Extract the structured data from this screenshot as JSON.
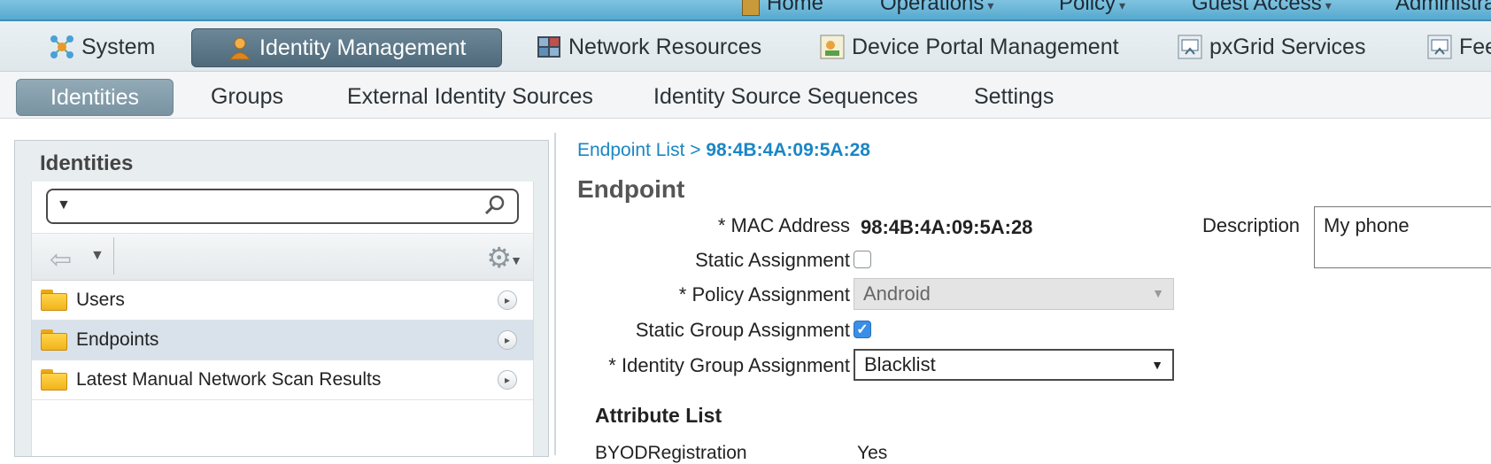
{
  "top_nav": {
    "items": [
      {
        "label": "Home",
        "caret": ""
      },
      {
        "label": "Operations",
        "caret": "▾"
      },
      {
        "label": "Policy",
        "caret": "▾"
      },
      {
        "label": "Guest Access",
        "caret": "▾"
      },
      {
        "label": "Administra",
        "caret": ""
      }
    ]
  },
  "main_tabs": [
    {
      "label": "System",
      "icon": "network-icon"
    },
    {
      "label": "Identity Management",
      "icon": "user-icon",
      "active": true
    },
    {
      "label": "Network Resources",
      "icon": "server-grid-icon"
    },
    {
      "label": "Device Portal Management",
      "icon": "portal-icon"
    },
    {
      "label": "pxGrid Services",
      "icon": "pxgrid-icon"
    },
    {
      "label": "Fee",
      "icon": "feed-icon"
    }
  ],
  "sub_tabs": [
    {
      "label": "Identities",
      "active": true
    },
    {
      "label": "Groups"
    },
    {
      "label": "External Identity Sources"
    },
    {
      "label": "Identity Source Sequences"
    },
    {
      "label": "Settings"
    }
  ],
  "left_panel": {
    "title": "Identities",
    "search_value": "",
    "tree": [
      {
        "label": "Users"
      },
      {
        "label": "Endpoints",
        "selected": true
      },
      {
        "label": "Latest Manual Network Scan Results"
      }
    ]
  },
  "breadcrumb": {
    "parent": "Endpoint List",
    "separator": ">",
    "current": "98:4B:4A:09:5A:28"
  },
  "endpoint": {
    "title": "Endpoint",
    "mac_label": "* MAC Address",
    "mac_value": "98:4B:4A:09:5A:28",
    "static_assignment_label": "Static Assignment",
    "static_assignment_checked": false,
    "policy_label": "* Policy Assignment",
    "policy_value": "Android",
    "static_group_label": "Static Group Assignment",
    "static_group_checked": true,
    "identity_group_label": "* Identity Group Assignment",
    "identity_group_value": "Blacklist",
    "description_label": "Description",
    "description_value": "My phone"
  },
  "attributes": {
    "title": "Attribute List",
    "rows": [
      {
        "name": "BYODRegistration",
        "value": "Yes"
      }
    ]
  },
  "colors": {
    "link": "#1a86c4",
    "active_tab": "#5a7585",
    "checkbox_on": "#3a8ee6",
    "folder": "#f2b31c"
  }
}
